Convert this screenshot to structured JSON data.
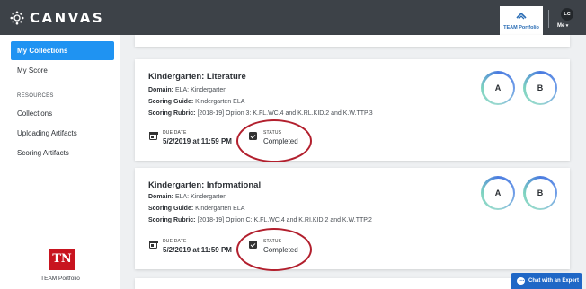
{
  "header": {
    "app_name": "CANVAS",
    "team_tab_label": "TEAM Portfolio",
    "avatar_initials": "LC",
    "user_menu_label": "Me"
  },
  "sidebar": {
    "items": [
      {
        "label": "My Collections",
        "active": true
      },
      {
        "label": "My Score"
      }
    ],
    "section_heading": "RESOURCES",
    "resource_items": [
      {
        "label": "Collections"
      },
      {
        "label": "Uploading Artifacts"
      },
      {
        "label": "Scoring Artifacts"
      }
    ],
    "footer_logo_text": "TN",
    "footer_label": "TEAM Portfolio"
  },
  "labels": {
    "domain": "Domain:",
    "guide": "Scoring Guide:",
    "rubric": "Scoring Rubric:",
    "due_date": "DUE DATE",
    "status": "STATUS"
  },
  "cards": [
    {
      "title": "Kindergarten: Literature",
      "domain": "ELA: Kindergarten",
      "scoring_guide": "Kindergarten ELA",
      "scoring_rubric": "[2018-19] Option 3: K.FL.WC.4 and K.RL.KID.2 and K.W.TTP.3",
      "due_date": "5/2/2019 at 11:59 PM",
      "status": "Completed",
      "score_circles": [
        "A",
        "B"
      ]
    },
    {
      "title": "Kindergarten: Informational",
      "domain": "ELA: Kindergarten",
      "scoring_guide": "Kindergarten ELA",
      "scoring_rubric": "[2018-19] Option C: K.FL.WC.4 and K.RI.KID.2 and K.W.TTP.2",
      "due_date": "5/2/2019 at 11:59 PM",
      "status": "Completed",
      "score_circles": [
        "A",
        "B"
      ]
    }
  ],
  "chat": {
    "label": "Chat with an Expert"
  },
  "colors": {
    "topbar": "#3d4248",
    "active_nav": "#1f93f2",
    "highlight_ring": "#b21f2d",
    "chat_button": "#1f67c6",
    "tn_logo": "#c8141f"
  }
}
